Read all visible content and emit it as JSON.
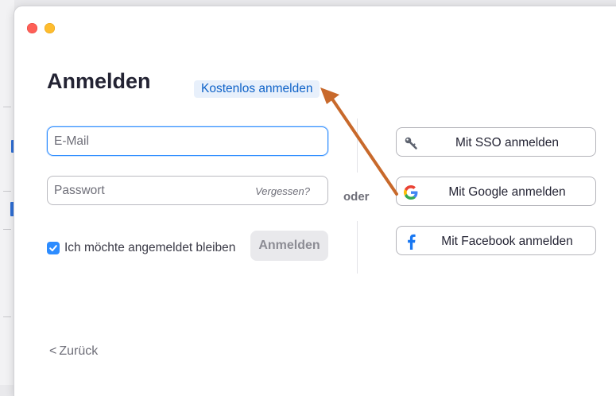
{
  "window": {
    "controls": [
      "close",
      "minimize"
    ]
  },
  "login": {
    "title": "Anmelden",
    "signup_link": "Kostenlos anmelden",
    "email_placeholder": "E-Mail",
    "password_placeholder": "Passwort",
    "forgot_link": "Vergessen?",
    "remember_label": "Ich möchte angemeldet bleiben",
    "remember_checked": true,
    "signin_button": "Anmelden"
  },
  "divider": {
    "or_label": "oder"
  },
  "sso": {
    "buttons": [
      {
        "label": "Mit SSO anmelden",
        "icon": "key-icon"
      },
      {
        "label": "Mit Google anmelden",
        "icon": "google-icon"
      },
      {
        "label": "Mit Facebook anmelden",
        "icon": "facebook-icon"
      }
    ]
  },
  "footer": {
    "back_label": "Zurück"
  },
  "colors": {
    "accent": "#2d8cff",
    "link": "#0e62c8",
    "annotation_arrow": "#c8692b"
  }
}
